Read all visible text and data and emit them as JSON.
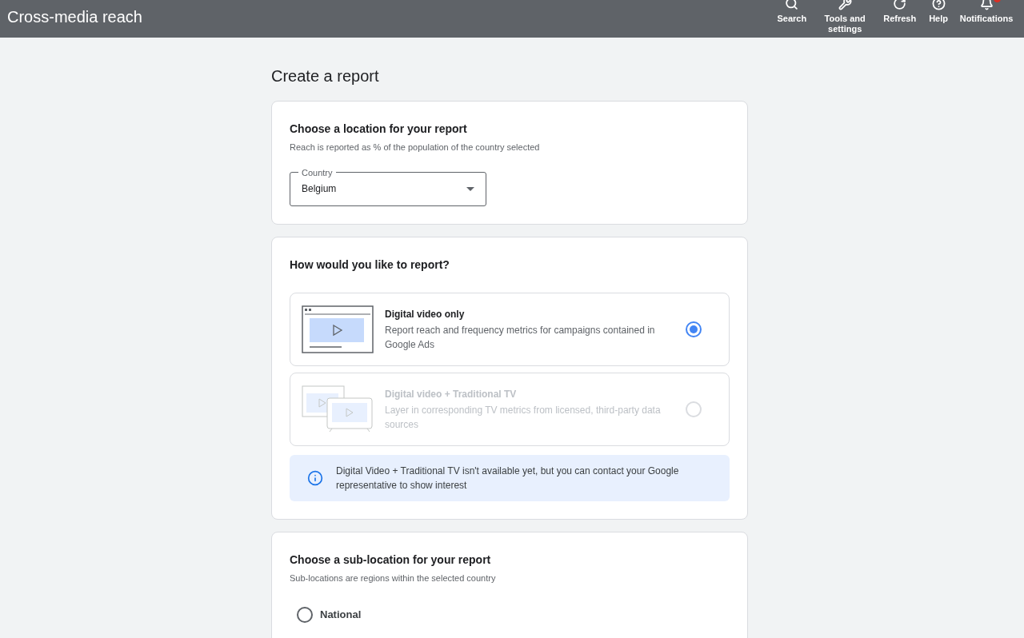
{
  "app_bar": {
    "title": "Cross-media reach",
    "actions": [
      {
        "kind": "search",
        "label": "Search"
      },
      {
        "kind": "tools",
        "label": "Tools and settings"
      },
      {
        "kind": "refresh",
        "label": "Refresh"
      },
      {
        "kind": "help",
        "label": "Help"
      },
      {
        "kind": "notifications",
        "label": "Notifications"
      }
    ]
  },
  "page_title": "Create a report",
  "location_card": {
    "title": "Choose a location for your report",
    "subtitle": "Reach is reported as % of the population of the country selected",
    "country": {
      "label": "Country",
      "value": "Belgium"
    }
  },
  "report_card": {
    "title": "How would you like to report?",
    "options": [
      {
        "kind": "video",
        "title": "Digital video only",
        "description": "Report reach and frequency metrics for campaigns contained in Google Ads",
        "selected": true,
        "disabled": false
      },
      {
        "kind": "video_tv",
        "title": "Digital video + Traditional TV",
        "description": "Layer in corresponding TV metrics from licensed, third-party data sources",
        "selected": false,
        "disabled": true
      }
    ],
    "info": "Digital Video + Traditional TV isn't available yet, but you can contact your Google representative to show interest"
  },
  "sublocation_card": {
    "title": "Choose a sub-location for your report",
    "subtitle": "Sub-locations are regions within the selected country",
    "options": [
      {
        "label": "National",
        "selected": false
      }
    ]
  }
}
